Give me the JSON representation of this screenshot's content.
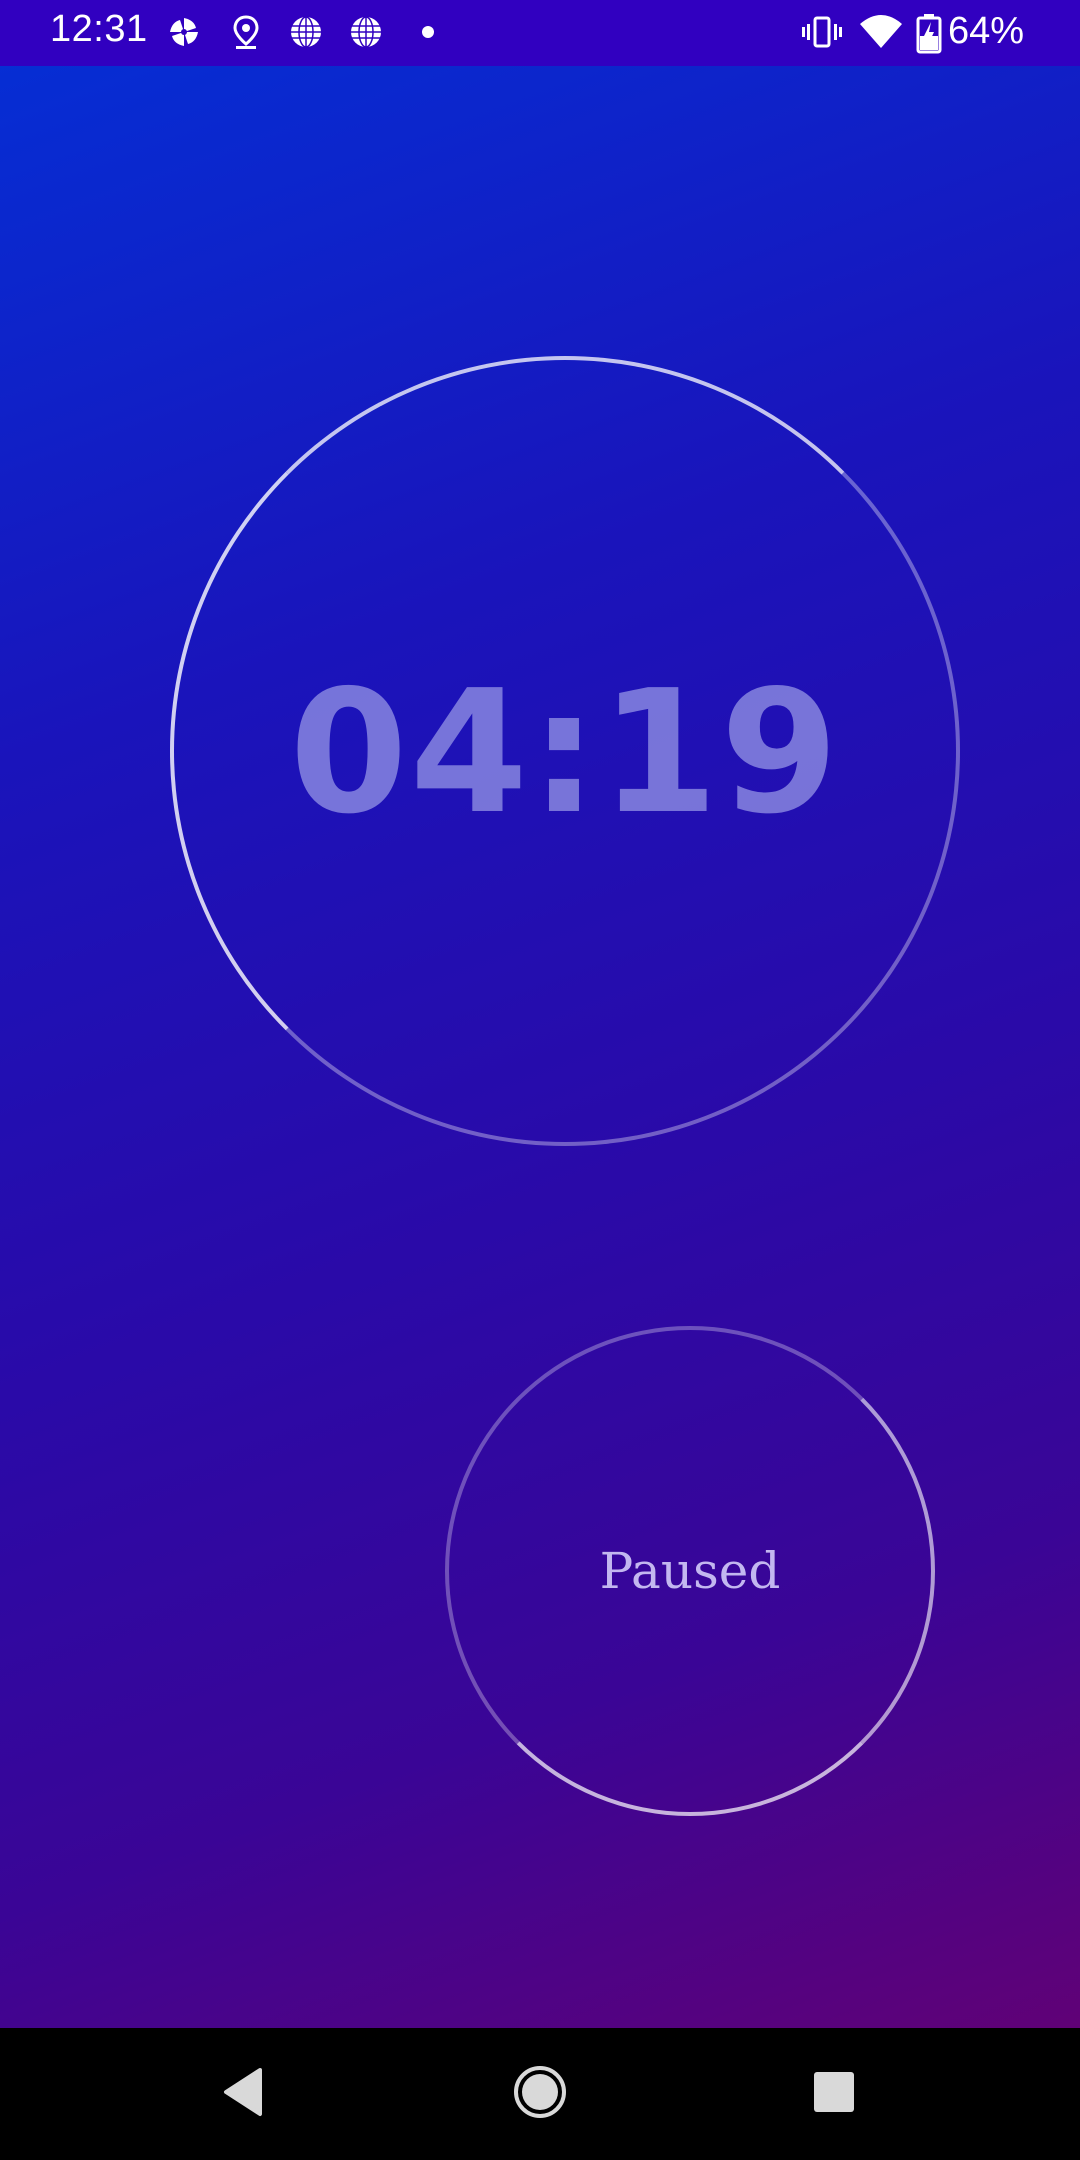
{
  "status_bar": {
    "time": "12:31",
    "battery_percent": "64%",
    "icons_left": [
      "pinwheel-icon",
      "location-pin-icon",
      "globe-icon",
      "globe-icon",
      "dot-icon"
    ],
    "icons_right": [
      "vibrate-icon",
      "wifi-icon",
      "battery-charging-icon"
    ]
  },
  "timer": {
    "display": "04:19"
  },
  "state_button": {
    "label": "Paused"
  },
  "nav": {
    "back_icon": "back-triangle-icon",
    "home_icon": "home-circle-icon",
    "recents_icon": "recents-square-icon"
  },
  "colors": {
    "status_bar_bg": "#3100c0",
    "gradient_top": "#0430d6",
    "gradient_bottom": "#6a006e",
    "timer_text": "#9696e6"
  }
}
